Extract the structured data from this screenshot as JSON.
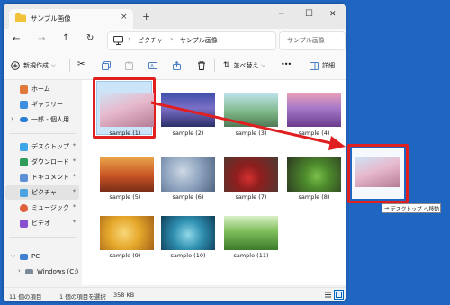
{
  "window": {
    "tab_title": "サンプル画像",
    "close_tab": "×",
    "new_tab": "+",
    "minimize": "─",
    "maximize": "☐",
    "close": "✕"
  },
  "address": {
    "crumbs": [
      "ピクチャ",
      "サンプル画像"
    ],
    "sep": "›",
    "search_placeholder": "サンプル画像"
  },
  "toolbar": {
    "new_label": "新規作成",
    "sort_label": "並べ替え",
    "more": "•••",
    "details_label": "詳細"
  },
  "nav": {
    "items": [
      {
        "label": "ホーム",
        "color": "#e0783a"
      },
      {
        "label": "ギャラリー",
        "color": "#3e8ee0"
      },
      {
        "label": "一郎 - 個人用",
        "color": "#2a7fd4"
      },
      {
        "label": "デスクトップ",
        "color": "#3da6e8"
      },
      {
        "label": "ダウンロード",
        "color": "#2f9c5a"
      },
      {
        "label": "ドキュメント",
        "color": "#5b8fd6"
      },
      {
        "label": "ピクチャ",
        "color": "#4aa3df"
      },
      {
        "label": "ミュージック",
        "color": "#e0603a"
      },
      {
        "label": "ビデオ",
        "color": "#8a4fd0"
      },
      {
        "label": "PC",
        "color": "#3e7fd0"
      },
      {
        "label": "Windows (C:)",
        "color": "#7a8a99"
      }
    ]
  },
  "files": [
    {
      "name": "sample (1)",
      "bg": "linear-gradient(160deg,#cfe2f5 0%,#e7b9cc 45%,#b57c95 100%)"
    },
    {
      "name": "sample (2)",
      "bg": "linear-gradient(180deg,#3e4fa8 0%,#7b6fc7 45%,#2b2f6a 100%)"
    },
    {
      "name": "sample (3)",
      "bg": "linear-gradient(180deg,#bfe3ee 0%,#7fb98a 55%,#4f7a55 100%)"
    },
    {
      "name": "sample (4)",
      "bg": "linear-gradient(180deg,#e9a0b8 0%,#a679c8 45%,#6b3c8e 100%)"
    },
    {
      "name": "sample (5)",
      "bg": "linear-gradient(180deg,#e9a34a 0%,#c65224 55%,#7a2e18 100%)"
    },
    {
      "name": "sample (6)",
      "bg": "radial-gradient(circle at 40% 40%,#cdd8e6 0%,#8aa0bb 50%,#4f6480 100%)"
    },
    {
      "name": "sample (7)",
      "bg": "radial-gradient(circle at 45% 60%,#d43030 0%,#8e1e1e 35%,#4a3b32 100%)"
    },
    {
      "name": "sample (8)",
      "bg": "radial-gradient(circle at 55% 55%,#7bbf4a 0%,#4d8a2c 35%,#2d3a22 100%)"
    },
    {
      "name": "sample (9)",
      "bg": "radial-gradient(circle at 45% 50%,#f7d67a 0%,#e6a82b 45%,#a5651a 100%)"
    },
    {
      "name": "sample (10)",
      "bg": "radial-gradient(circle at 50% 55%,#8fd8e8 0%,#2f8fb0 45%,#0f3e5a 100%)"
    },
    {
      "name": "sample (11)",
      "bg": "linear-gradient(180deg,#d9efc5 0%,#7ebe5a 45%,#3c7a2a 100%)"
    }
  ],
  "status": {
    "count": "11 個の項目",
    "selected": "1 個の項目を選択",
    "size": "358 KB"
  },
  "drag": {
    "tooltip_arrow": "→",
    "tooltip": "デスクトップ へ移動"
  },
  "colors": {
    "desktop": "#1f66c2",
    "highlight": "#e02020",
    "selection": "#cce4f7",
    "accent": "#0067c0"
  }
}
